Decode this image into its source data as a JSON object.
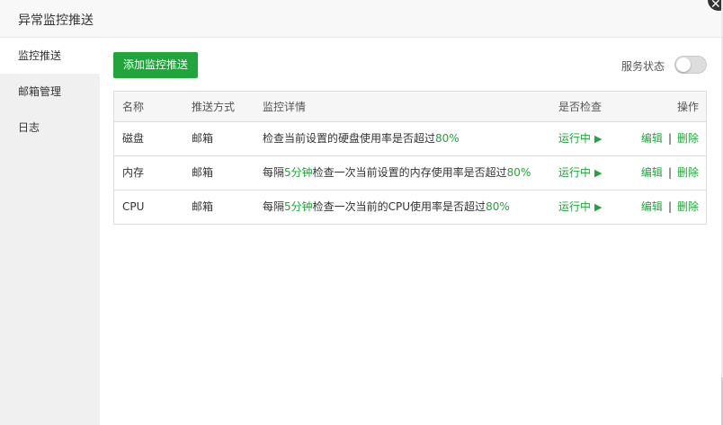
{
  "dialog": {
    "title": "异常监控推送"
  },
  "sidebar": {
    "items": [
      {
        "label": "监控推送",
        "active": true
      },
      {
        "label": "邮箱管理",
        "active": false
      },
      {
        "label": "日志",
        "active": false
      }
    ]
  },
  "toolbar": {
    "add_label": "添加监控推送",
    "service_status_label": "服务状态",
    "service_enabled": false
  },
  "table": {
    "headers": {
      "name": "名称",
      "method": "推送方式",
      "detail": "监控详情",
      "check": "是否检查",
      "ops": "操作"
    },
    "rows": [
      {
        "name": "磁盘",
        "method": "邮箱",
        "detail_pre": "检查当前设置的硬盘使用率是否超过",
        "detail_hl1": "",
        "detail_mid": "",
        "detail_hl2": "80%",
        "check": "运行中",
        "edit": "编辑",
        "sep": "|",
        "delete": "删除"
      },
      {
        "name": "内存",
        "method": "邮箱",
        "detail_pre": "每隔",
        "detail_hl1": "5分钟",
        "detail_mid": "检查一次当前设置的内存使用率是否超过",
        "detail_hl2": "80%",
        "check": "运行中",
        "edit": "编辑",
        "sep": "|",
        "delete": "删除"
      },
      {
        "name": "CPU",
        "method": "邮箱",
        "detail_pre": "每隔",
        "detail_hl1": "5分钟",
        "detail_mid": "检查一次当前的CPU使用率是否超过",
        "detail_hl2": "80%",
        "check": "运行中",
        "edit": "编辑",
        "sep": "|",
        "delete": "删除"
      }
    ]
  },
  "icons": {
    "close": "close-icon",
    "play": "play-icon"
  },
  "colors": {
    "accent": "#20a53a",
    "sidebar_bg": "#f0f0f0",
    "header_bg": "#f8f8f8"
  }
}
